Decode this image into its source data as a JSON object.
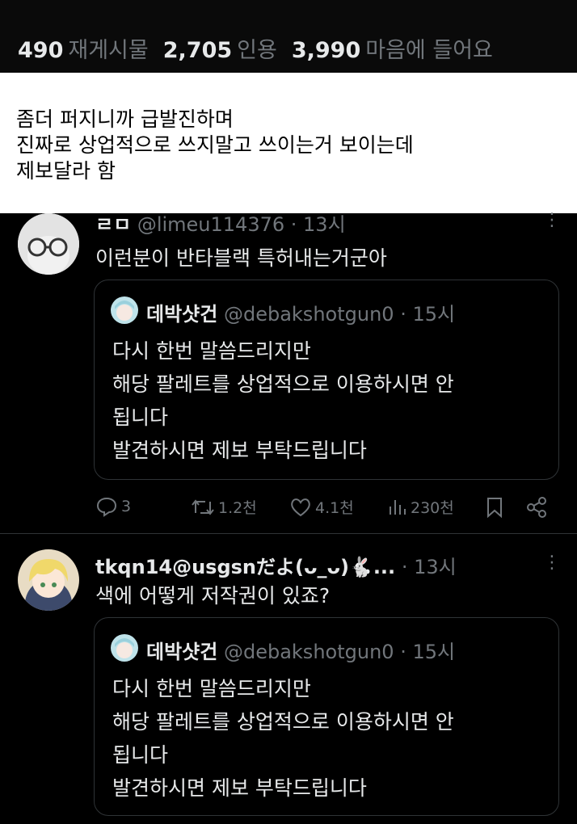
{
  "stats": {
    "reposts_count": "490",
    "reposts_label": "재게시물",
    "quotes_count": "2,705",
    "quotes_label": "인용",
    "likes_count": "3,990",
    "likes_label": "마음에 들어요"
  },
  "caption": {
    "line1": "좀더 퍼지니까 급발진하며",
    "line2": "진짜로 상업적으로 쓰지말고 쓰이는거 보이는데",
    "line3": "제보달라 함"
  },
  "reply1": {
    "name": "ㄹㅁ",
    "handle": "@limeu114376",
    "time": "· 13시",
    "text": "이런분이 반타블랙 특허내는거군아",
    "quote": {
      "name": "데박샷건",
      "handle": "@debakshotgun0",
      "time": "· 15시",
      "lines": [
        "다시 한번 말씀드리지만",
        "해당 팔레트를 상업적으로 이용하시면 안",
        "됩니다",
        "발견하시면 제보 부탁드립니다"
      ]
    },
    "actions": {
      "replies": "3",
      "reposts": "1.2천",
      "likes": "4.1천",
      "views": "230천"
    }
  },
  "reply2": {
    "name": "tkqn14@usgsnだよ(ᴗ_ᴗ)🐇...",
    "handle": "",
    "time": "· 13시",
    "text": "색에 어떻게 저작권이 있죠?",
    "quote": {
      "name": "데박샷건",
      "handle": "@debakshotgun0",
      "time": "· 15시",
      "lines": [
        "다시 한번 말씀드리지만",
        "해당 팔레트를 상업적으로 이용하시면 안",
        "됩니다",
        "발견하시면 제보 부탁드립니다"
      ]
    }
  },
  "colors": {
    "background": "#000000",
    "secondary_text": "#71767b",
    "border": "#2f3336",
    "caption_bg": "#ffffff"
  },
  "icons": [
    "reply-icon",
    "repost-icon",
    "like-icon",
    "views-icon",
    "bookmark-icon",
    "share-icon",
    "more-icon"
  ]
}
